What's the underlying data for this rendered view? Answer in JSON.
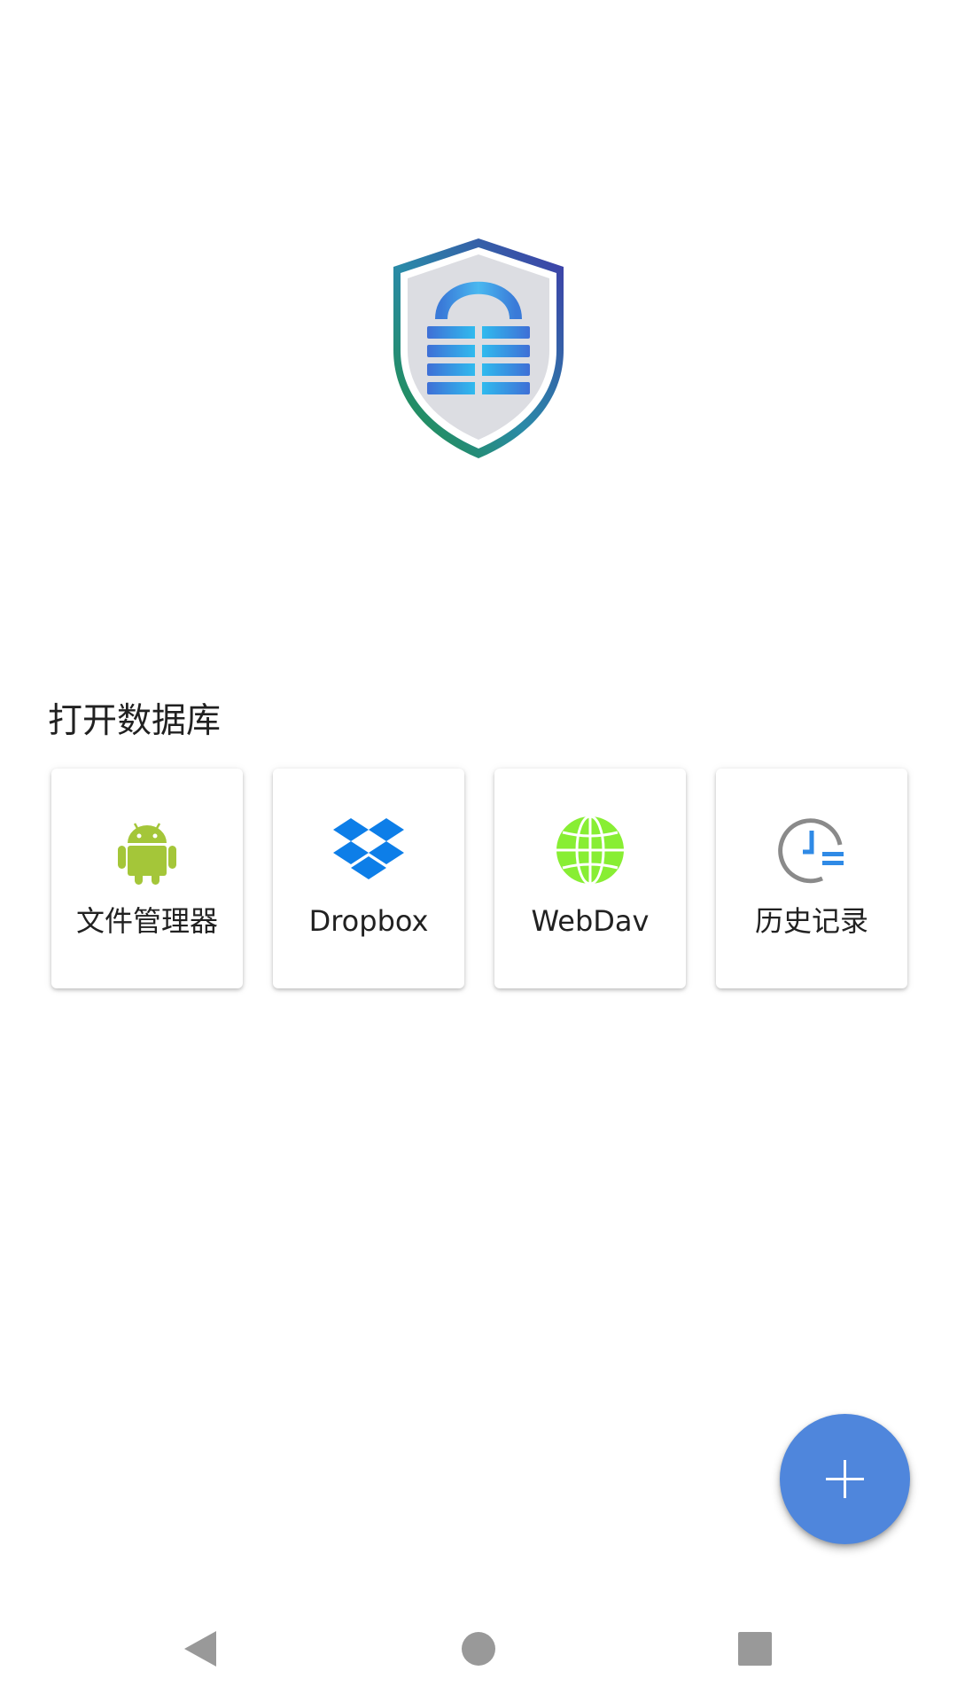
{
  "app": {
    "logo_name": "shield-lock-logo"
  },
  "open_database": {
    "title": "打开数据库",
    "sources": [
      {
        "label": "文件管理器",
        "icon": "android-icon",
        "color": "#a4c639"
      },
      {
        "label": "Dropbox",
        "icon": "dropbox-icon",
        "color": "#0d7ee8"
      },
      {
        "label": "WebDav",
        "icon": "globe-icon",
        "color": "#88ee33"
      },
      {
        "label": "历史记录",
        "icon": "history-clock-icon",
        "color": "#8a8a8a"
      }
    ]
  },
  "fab": {
    "icon": "plus-icon",
    "color": "#4f86dc"
  },
  "navigation_bar": {
    "buttons": [
      {
        "name": "back",
        "icon": "back-triangle-icon"
      },
      {
        "name": "home",
        "icon": "home-circle-icon"
      },
      {
        "name": "recents",
        "icon": "recents-square-icon"
      }
    ]
  }
}
